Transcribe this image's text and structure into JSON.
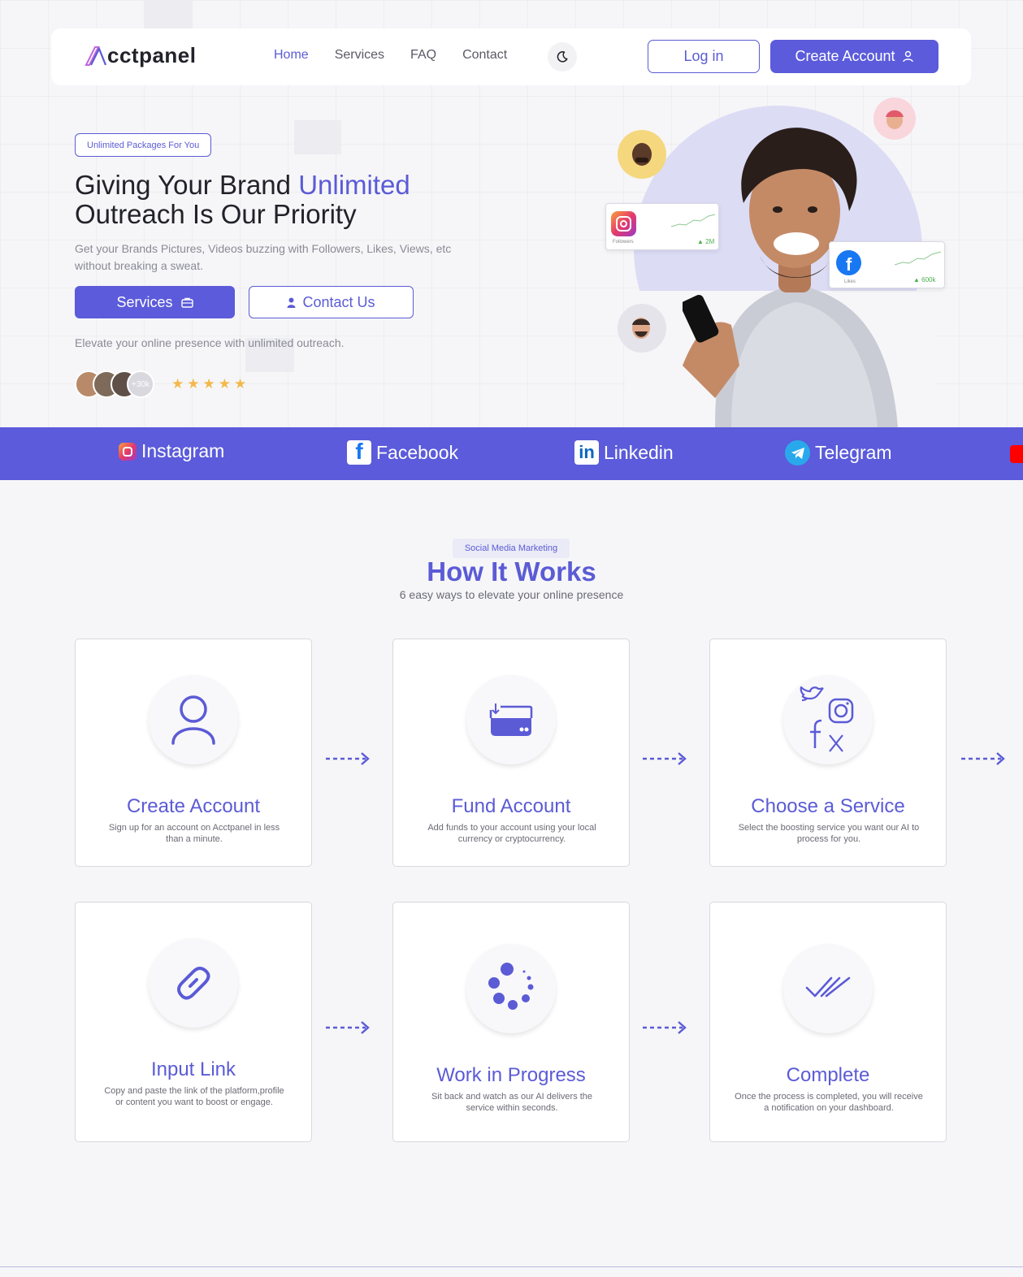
{
  "brand": {
    "logo_text": "cctpanel",
    "accent": "#5b5bdb"
  },
  "nav": {
    "links": [
      {
        "label": "Home",
        "active": true
      },
      {
        "label": "Services",
        "active": false
      },
      {
        "label": "FAQ",
        "active": false
      },
      {
        "label": "Contact",
        "active": false
      }
    ],
    "theme_icon": "moon-icon",
    "login_label": "Log in",
    "create_label": "Create Account"
  },
  "hero": {
    "badge": "Unlimited Packages For You",
    "title_part1": "Giving Your Brand ",
    "title_accent": "Unlimited",
    "title_part2": "Outreach Is Our Priority",
    "subtitle": "Get your Brands Pictures, Videos buzzing with Followers, Likes, Views, etc without breaking a sweat.",
    "services_label": "Services",
    "contact_label": "Contact Us",
    "tagline": "Elevate your online presence with unlimited outreach.",
    "avatars_more": "+30k",
    "rating": 5,
    "stats": [
      {
        "icon": "instagram-icon",
        "label": "Followers",
        "value": "2M"
      },
      {
        "icon": "facebook-icon",
        "label": "Likes",
        "value": "600k"
      }
    ]
  },
  "social_strip": [
    {
      "label": "Instagram",
      "icon": "instagram-icon"
    },
    {
      "label": "Facebook",
      "icon": "facebook-icon"
    },
    {
      "label": "Linkedin",
      "icon": "linkedin-icon"
    },
    {
      "label": "Telegram",
      "icon": "telegram-icon"
    }
  ],
  "how": {
    "badge": "Social Media Marketing",
    "title": "How It Works",
    "subtitle": "6 easy ways to elevate your online presence",
    "steps": [
      {
        "title": "Create Account",
        "desc": "Sign up for an account on Acctpanel in less than a minute.",
        "icon": "user-icon"
      },
      {
        "title": "Fund Account",
        "desc": "Add funds to your account using your local currency or cryptocurrency.",
        "icon": "wallet-icon"
      },
      {
        "title": "Choose a Service",
        "desc": "Select the boosting service you want our AI to process for you.",
        "icon": "social-icons"
      },
      {
        "title": "Input Link",
        "desc": "Copy and paste the link of the platform,profile or content you want to boost or engage.",
        "icon": "link-icon"
      },
      {
        "title": "Work in Progress",
        "desc": "Sit back and watch as our AI delivers the service within seconds.",
        "icon": "spinner-icon"
      },
      {
        "title": "Complete",
        "desc": "Once the process is completed, you will receive a notification on your dashboard.",
        "icon": "double-check-icon"
      }
    ]
  }
}
